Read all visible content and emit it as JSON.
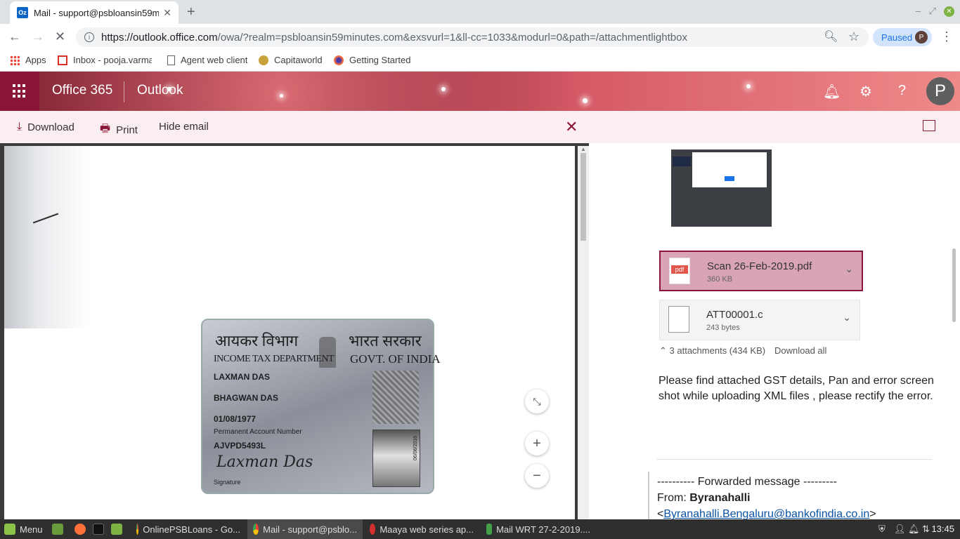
{
  "browser": {
    "tab_title": "Mail - support@psbloansin59m",
    "tab_favicon_text": "Oz",
    "url_host": "https://outlook.office.com",
    "url_path": "/owa/?realm=psbloansin59minutes.com&exsvurl=1&ll-cc=1033&modurl=0&path=/attachmentlightbox",
    "paused_label": "Paused",
    "profile_initial": "P",
    "bookmarks": [
      {
        "label": "Apps",
        "icon": "apps-grid-icon"
      },
      {
        "label": "Inbox - pooja.varma",
        "icon": "gmail-icon"
      },
      {
        "label": "Agent web client",
        "icon": "page-icon"
      },
      {
        "label": "Capitaworld",
        "icon": "capitaworld-icon"
      },
      {
        "label": "Getting Started",
        "icon": "firefox-icon"
      }
    ]
  },
  "office": {
    "suite_name": "Office 365",
    "app_name": "Outlook",
    "avatar_initial": "P",
    "accent": "#8a1538"
  },
  "actions": {
    "download": "Download",
    "print": "Print",
    "hide_email": "Hide email"
  },
  "pan_card": {
    "hindi_dept": "आयकर विभाग",
    "hindi_govt": "भारत सरकार",
    "dept": "INCOME TAX DEPARTMENT",
    "govt": "GOVT. OF INDIA",
    "name": "LAXMAN DAS",
    "father": "BHAGWAN DAS",
    "dob": "01/08/1977",
    "pan_label": "Permanent Account Number",
    "pan_number": "AJVPD5493L",
    "signature_label": "Signature",
    "signature_text": "Laxman Das",
    "side_date": "06/06/2016"
  },
  "attachments": [
    {
      "name": "Scan 26-Feb-2019.pdf",
      "size": "360 KB",
      "type": "pdf"
    },
    {
      "name": "ATT00001.c",
      "size": "243 bytes",
      "type": "file"
    }
  ],
  "attachment_summary": "3 attachments (434 KB)",
  "download_all": "Download all",
  "email_body": "Please find attached GST details, Pan and error screen shot while uploading XML files , please rectify the error.",
  "forwarded": {
    "header": "---------- Forwarded message ---------",
    "from_label": "From:",
    "from_name": "Byranahalli",
    "from_email": "Byranahalli.Bengaluru@bankofindia.co.in"
  },
  "taskbar": {
    "menu_label": "Menu",
    "windows": [
      {
        "label": "OnlinePSBLoans - Go...",
        "icon": "chrome-icon",
        "active": false
      },
      {
        "label": "Mail - support@psblo...",
        "icon": "chrome-icon",
        "active": true
      },
      {
        "label": "Maaya web series ap...",
        "icon": "opera-icon",
        "active": false
      },
      {
        "label": "Mail WRT 27-2-2019....",
        "icon": "spreadsheet-icon",
        "active": false
      }
    ],
    "clock": "13:45"
  }
}
